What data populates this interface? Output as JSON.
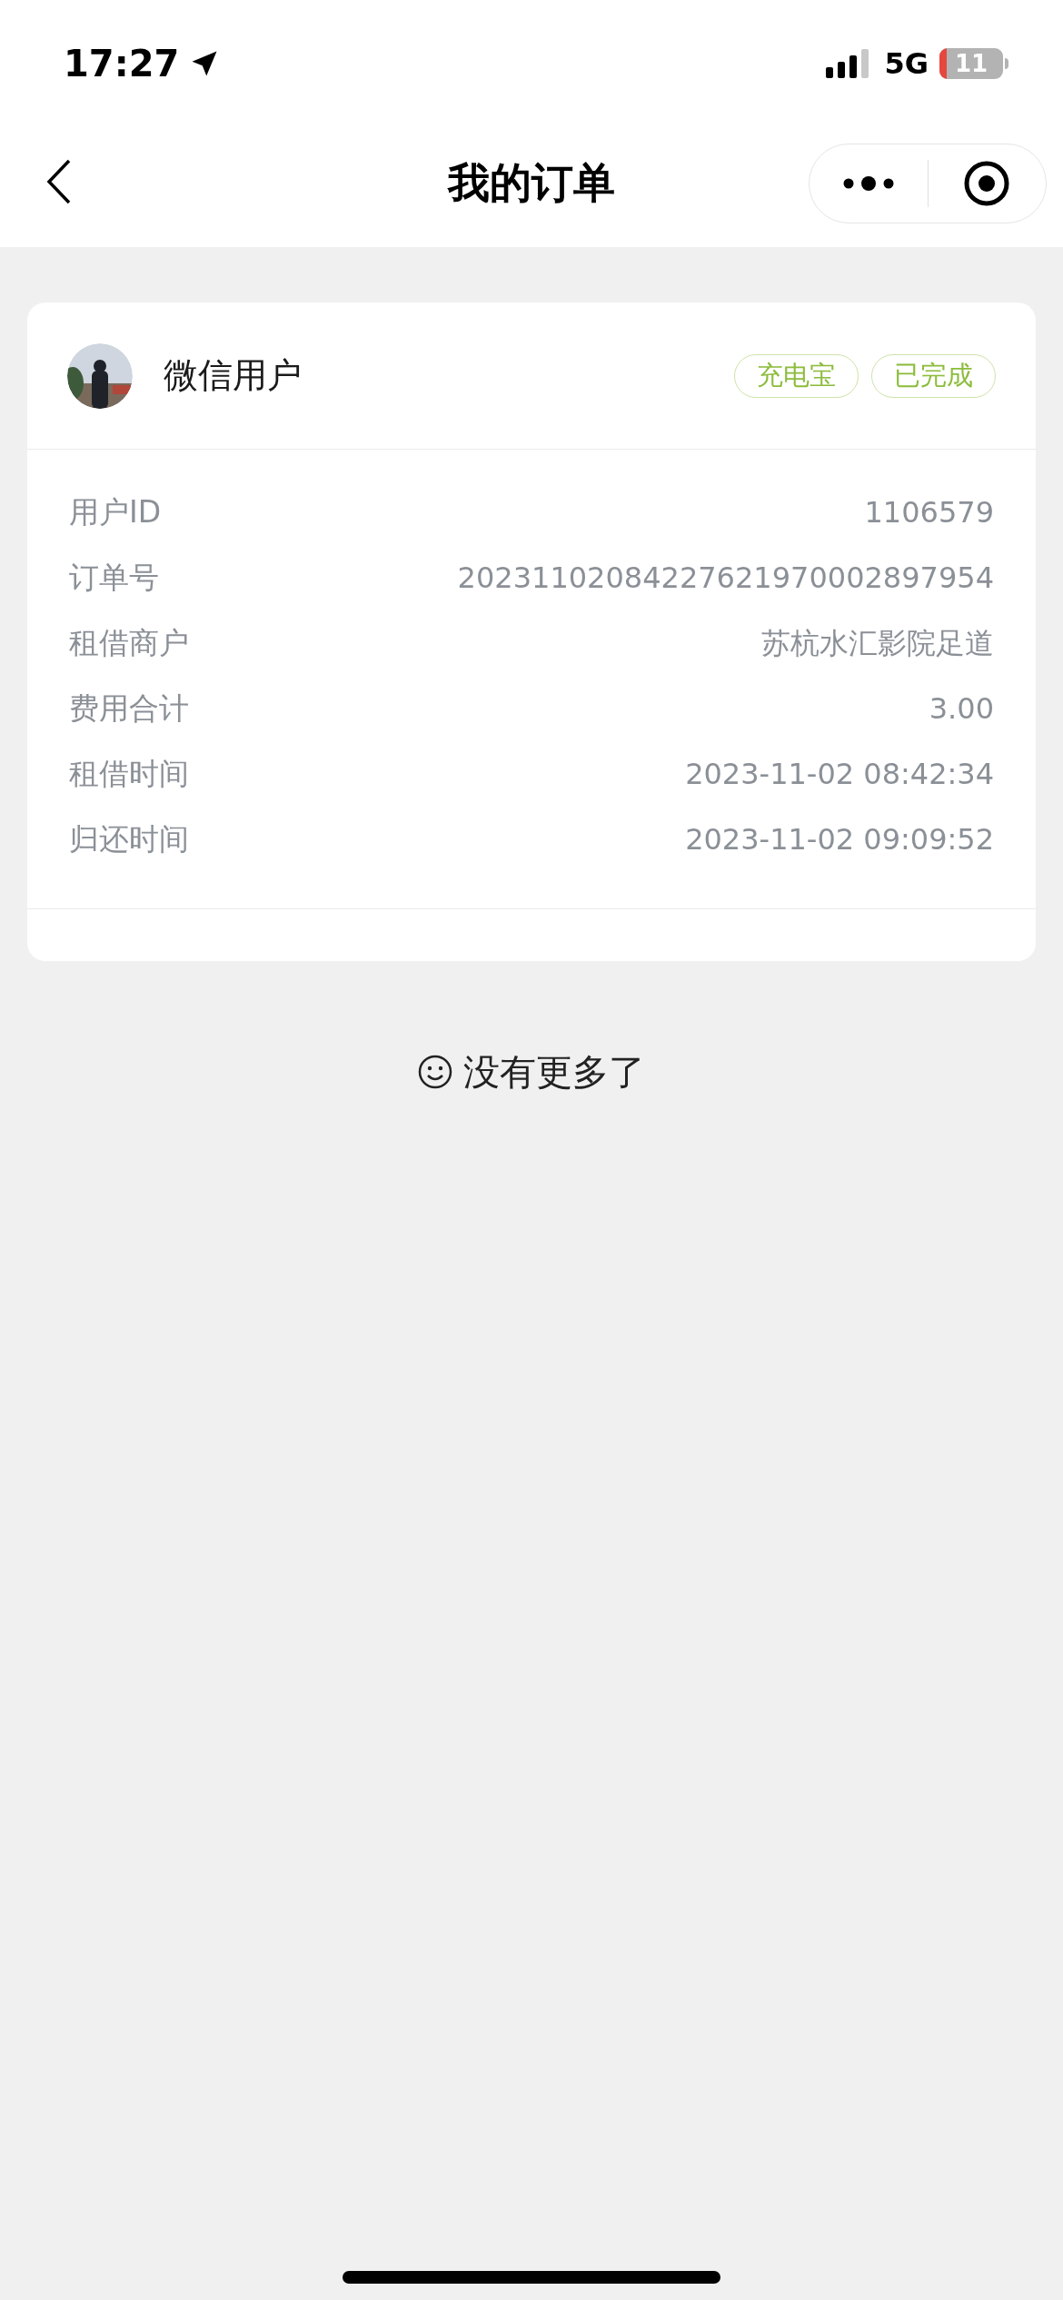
{
  "status_bar": {
    "time": "17:27",
    "network": "5G",
    "battery": "11"
  },
  "nav": {
    "title": "我的订单"
  },
  "order": {
    "user_name": "微信用户",
    "tags": [
      {
        "label": "充电宝"
      },
      {
        "label": "已完成"
      }
    ],
    "details": [
      {
        "label": "用户ID",
        "value": "1106579"
      },
      {
        "label": "订单号",
        "value": "20231102084227621970002897954"
      },
      {
        "label": "租借商户",
        "value": "苏杭水汇影院足道"
      },
      {
        "label": "费用合计",
        "value": "3.00"
      },
      {
        "label": "租借时间",
        "value": "2023-11-02 08:42:34"
      },
      {
        "label": "归还时间",
        "value": "2023-11-02 09:09:52"
      }
    ]
  },
  "end_message": "没有更多了"
}
